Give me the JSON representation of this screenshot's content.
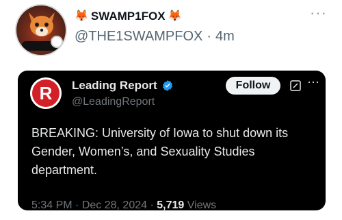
{
  "post": {
    "display_name": "SWAMP1FOX",
    "emoji_left": "🦊",
    "emoji_right": "🦊",
    "handle": "@THE1SWAMPFOX",
    "separator": "·",
    "time": "4m"
  },
  "quoted": {
    "logo_letter": "R",
    "name": "Leading Report",
    "handle": "@LeadingReport",
    "follow_label": "Follow",
    "text": "BREAKING: University of Iowa to shut down its Gender, Women’s, and Sexuality Studies department.",
    "time": "5:34 PM",
    "date": "Dec 28, 2024",
    "dot": "·",
    "views_count": "5,719",
    "views_label": "Views"
  },
  "colors": {
    "card_bg": "#000000",
    "verified": "#1d9bf0",
    "brand_red": "#d32027"
  },
  "icons": [
    "more-horizontal-icon",
    "verified-badge-icon",
    "compose-icon",
    "avatar-fox-icon"
  ]
}
